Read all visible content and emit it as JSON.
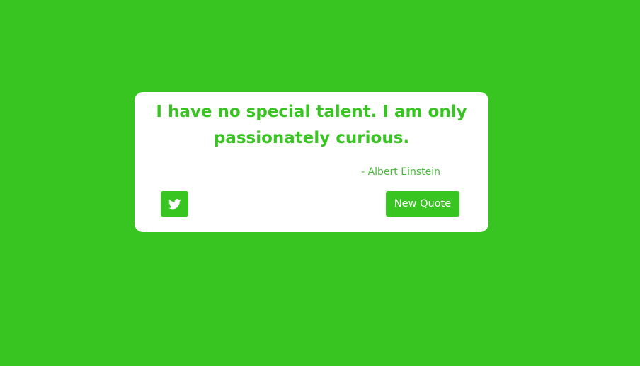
{
  "colors": {
    "background": "#38c421",
    "card": "#ffffff",
    "accent": "#38c421",
    "button_text": "#ffffff"
  },
  "quote": {
    "text": "I have no special talent. I am only passionately curious.",
    "author": "- Albert Einstein"
  },
  "actions": {
    "tweet_icon": "twitter-icon",
    "new_quote_label": "New Quote"
  }
}
